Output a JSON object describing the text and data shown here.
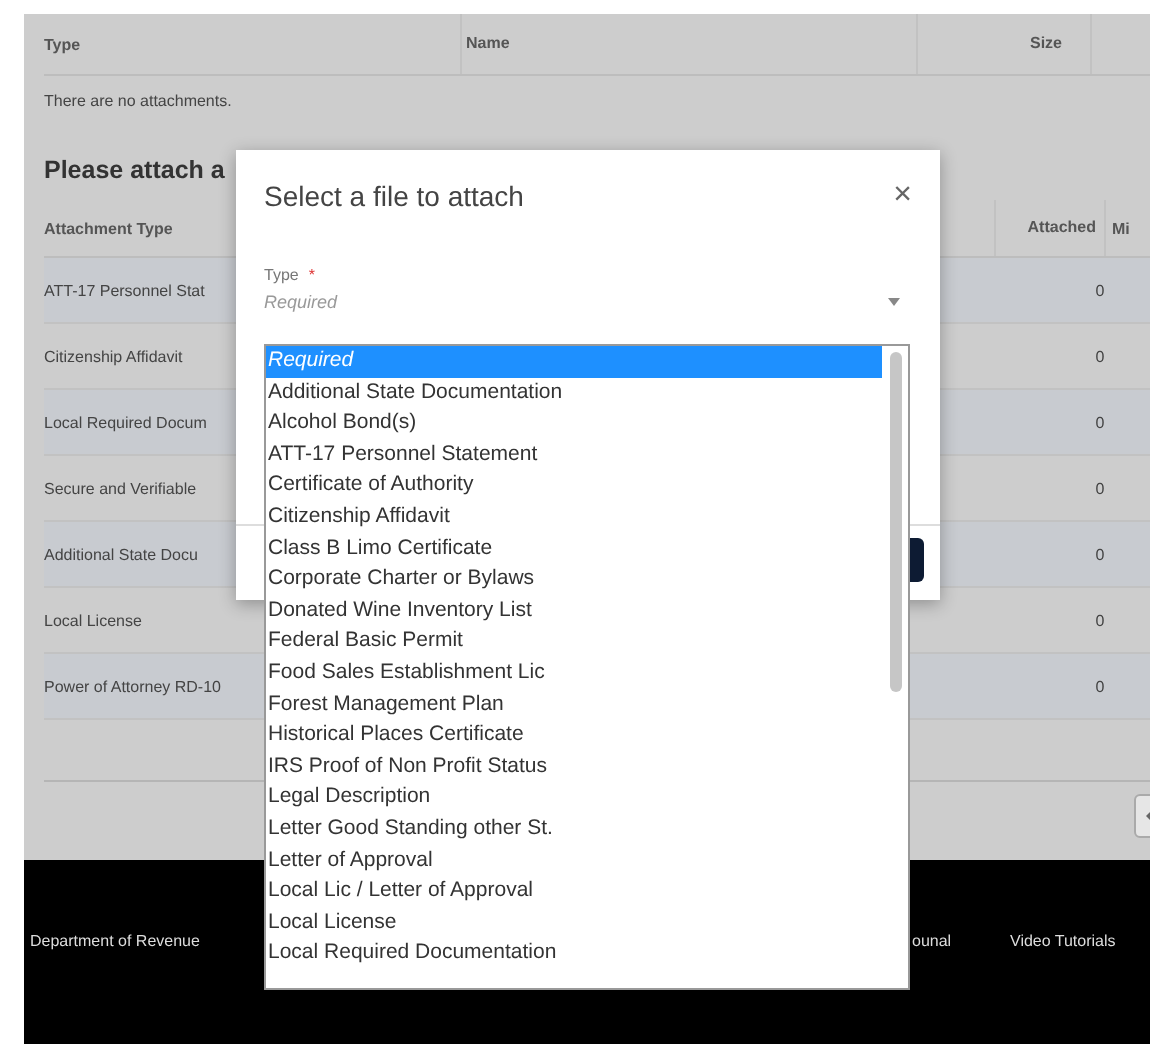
{
  "attachments_table": {
    "columns": [
      "Type",
      "Name",
      "Size"
    ],
    "empty_message": "There are no attachments."
  },
  "required_section": {
    "heading": "Please attach a",
    "columns": [
      "Attachment Type",
      "Attached",
      "Mi"
    ],
    "rows": [
      {
        "attachment_type": "ATT-17 Personnel Stat",
        "attached": "0"
      },
      {
        "attachment_type": "Citizenship Affidavit",
        "attached": "0"
      },
      {
        "attachment_type": "Local Required Docum",
        "attached": "0"
      },
      {
        "attachment_type": "Secure and Verifiable",
        "attached": "0"
      },
      {
        "attachment_type": "Additional State Docu",
        "attached": "0"
      },
      {
        "attachment_type": "Local License",
        "attached": "0"
      },
      {
        "attachment_type": "Power of Attorney RD-10",
        "attached": "0"
      }
    ]
  },
  "dialog": {
    "title": "Select a file to attach",
    "close": "×",
    "type_field": {
      "label": "Type",
      "required_mark": "*",
      "placeholder": "Required"
    },
    "options": [
      {
        "label": "Required",
        "kind": "placeholder",
        "selected": true
      },
      {
        "label": "Additional State Documentation",
        "kind": "option",
        "selected": false
      },
      {
        "label": "Alcohol Bond(s)",
        "kind": "option",
        "selected": false
      },
      {
        "label": "ATT-17 Personnel Statement",
        "kind": "option",
        "selected": false
      },
      {
        "label": "Certificate of Authority",
        "kind": "option",
        "selected": false
      },
      {
        "label": "Citizenship Affidavit",
        "kind": "option",
        "selected": false
      },
      {
        "label": "Class B Limo Certificate",
        "kind": "option",
        "selected": false
      },
      {
        "label": "Corporate Charter or Bylaws",
        "kind": "option",
        "selected": false
      },
      {
        "label": "Donated Wine Inventory List",
        "kind": "option",
        "selected": false
      },
      {
        "label": "Federal Basic Permit",
        "kind": "option",
        "selected": false
      },
      {
        "label": "Food Sales Establishment Lic",
        "kind": "option",
        "selected": false
      },
      {
        "label": "Forest Management Plan",
        "kind": "option",
        "selected": false
      },
      {
        "label": "Historical Places Certificate",
        "kind": "option",
        "selected": false
      },
      {
        "label": "IRS Proof of Non Profit Status",
        "kind": "option",
        "selected": false
      },
      {
        "label": "Legal Description",
        "kind": "option",
        "selected": false
      },
      {
        "label": "Letter Good Standing other St.",
        "kind": "option",
        "selected": false
      },
      {
        "label": "Letter of Approval",
        "kind": "option",
        "selected": false
      },
      {
        "label": "Local Lic / Letter of Approval",
        "kind": "option",
        "selected": false
      },
      {
        "label": "Local License",
        "kind": "option",
        "selected": false
      },
      {
        "label": "Local Required Documentation",
        "kind": "option",
        "selected": false
      }
    ]
  },
  "footer": {
    "links": [
      "Department of Revenue",
      "ounal",
      "Video Tutorials"
    ]
  }
}
